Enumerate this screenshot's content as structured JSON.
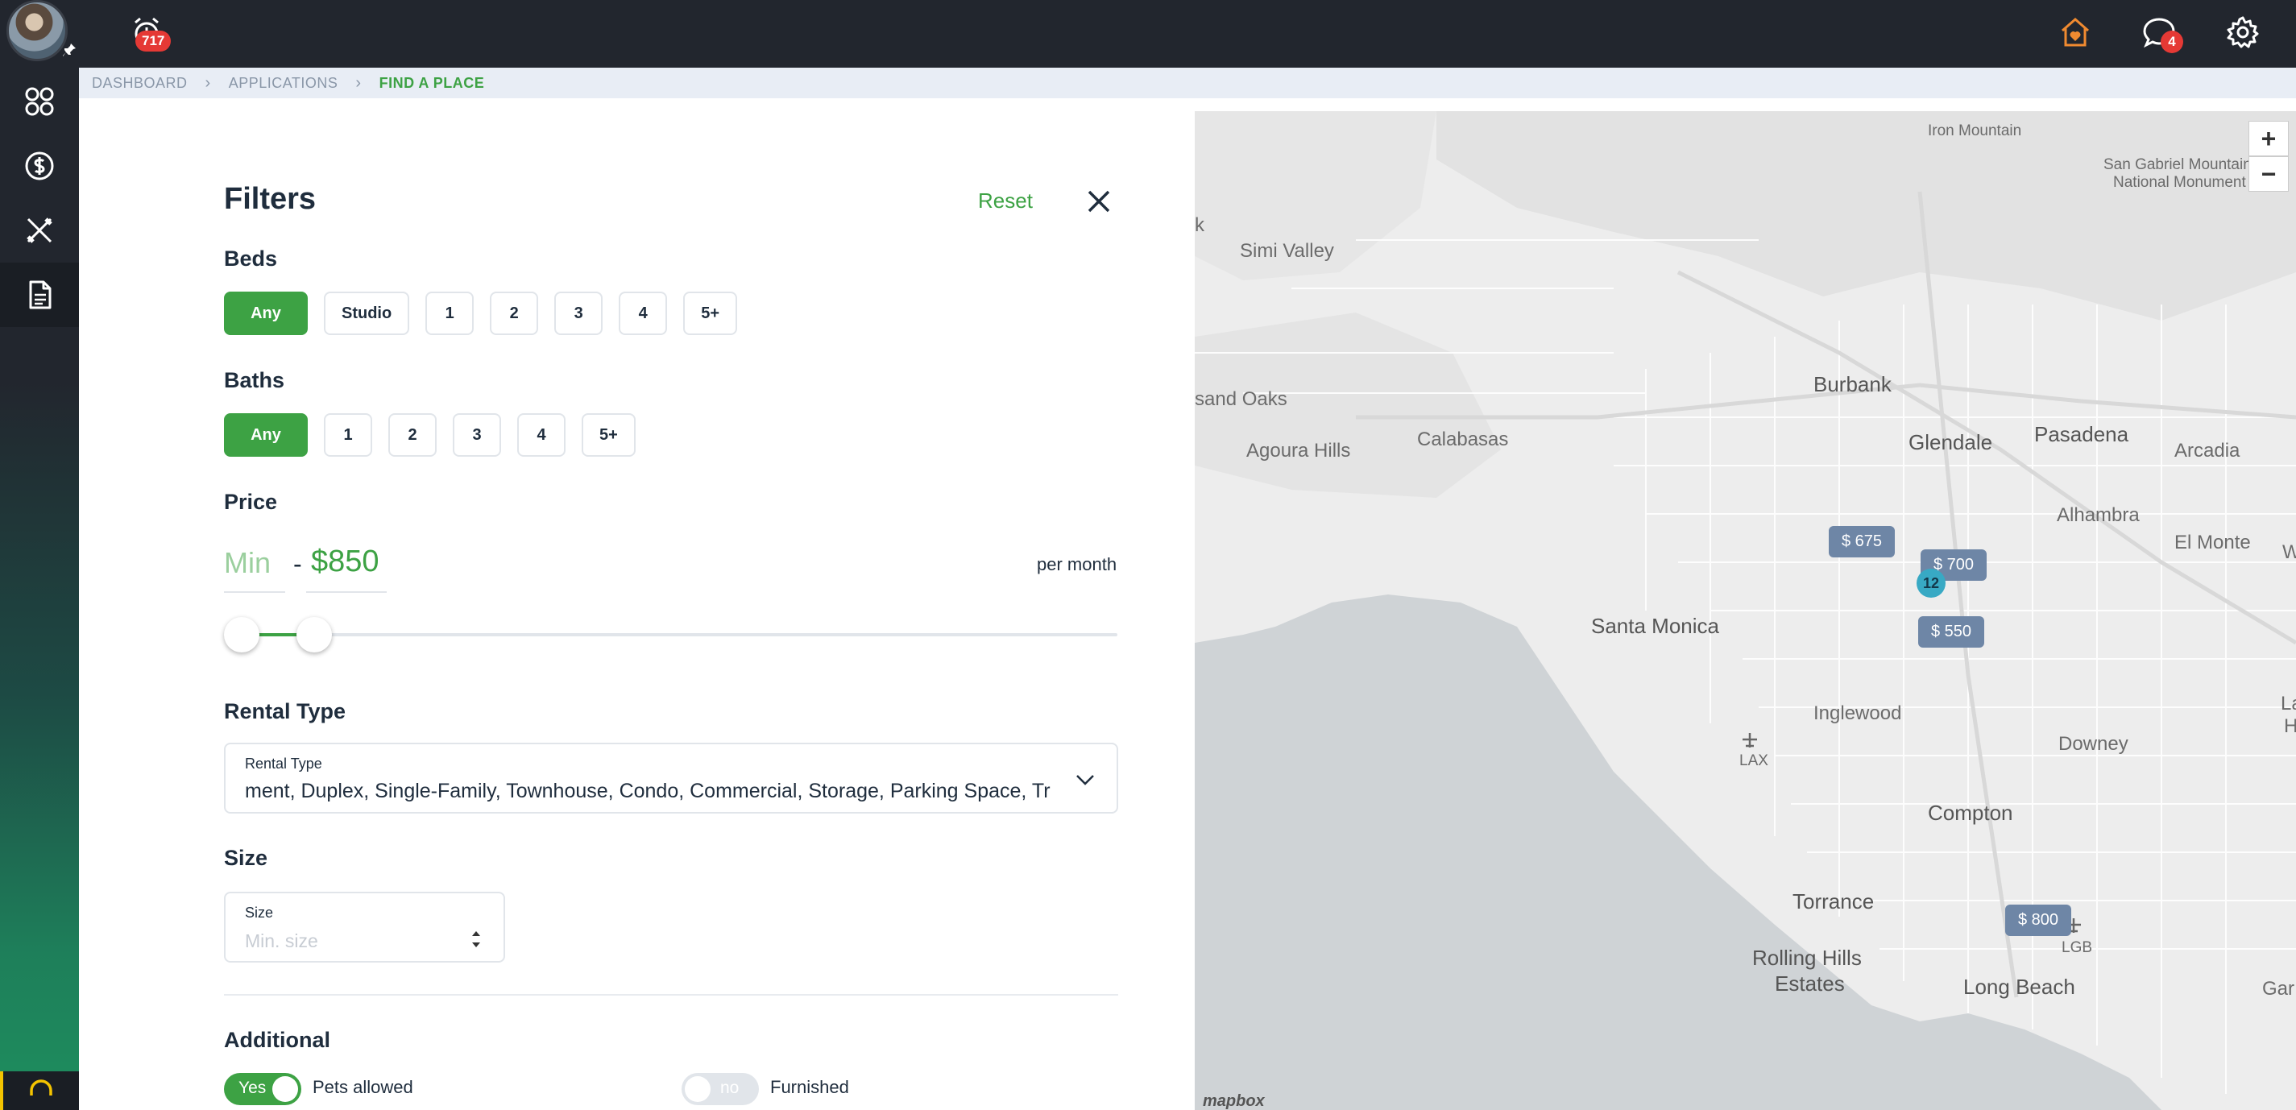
{
  "topbar": {
    "alarm_count": "717",
    "messages_count": "4"
  },
  "breadcrumb": {
    "items": [
      "DASHBOARD",
      "APPLICATIONS",
      "FIND A PLACE"
    ],
    "separator": "›"
  },
  "filters": {
    "title": "Filters",
    "reset_label": "Reset",
    "beds": {
      "label": "Beds",
      "options": [
        "Any",
        "Studio",
        "1",
        "2",
        "3",
        "4",
        "5+"
      ],
      "selected": "Any"
    },
    "baths": {
      "label": "Baths",
      "options": [
        "Any",
        "1",
        "2",
        "3",
        "4",
        "5+"
      ],
      "selected": "Any"
    },
    "price": {
      "label": "Price",
      "min_placeholder": "Min",
      "dash": "-",
      "max_value": "$850",
      "period": "per month"
    },
    "rental_type": {
      "section_label": "Rental Type",
      "field_label": "Rental Type",
      "value": "ment, Duplex, Single-Family, Townhouse, Condo, Commercial, Storage, Parking Space, Triplex"
    },
    "size": {
      "section_label": "Size",
      "field_label": "Size",
      "placeholder": "Min. size"
    },
    "additional": {
      "label": "Additional",
      "pets": {
        "toggle_text": "Yes",
        "label": "Pets allowed",
        "on": true
      },
      "furnished": {
        "toggle_text": "no",
        "label": "Furnished",
        "on": false
      }
    }
  },
  "map": {
    "places": [
      "Iron Mountain",
      "San Gabriel Mountains",
      "National Monument",
      "Simi Valley",
      "Burbank",
      "Glendale",
      "Pasadena",
      "Arcadia",
      "sand Oaks",
      "Agoura Hills",
      "Calabasas",
      "Alhambra",
      "El Monte",
      "W",
      "Santa Monica",
      "Inglewood",
      "LAX",
      "Downey",
      "La",
      "H",
      "Compton",
      "Torrance",
      "Rolling Hills",
      "Estates",
      "Long Beach",
      "LGB",
      "Gar",
      "k"
    ],
    "price_tags": [
      "$ 675",
      "$ 700",
      "$ 550",
      "$ 800"
    ],
    "cluster_count": "12",
    "zoom_in": "+",
    "zoom_out": "−",
    "attribution": "mapbox"
  },
  "colors": {
    "accent": "#3da244",
    "topbar": "#22262e",
    "price_tag": "#6e86a6",
    "cluster": "#38a9c4",
    "badge": "#e53935"
  }
}
